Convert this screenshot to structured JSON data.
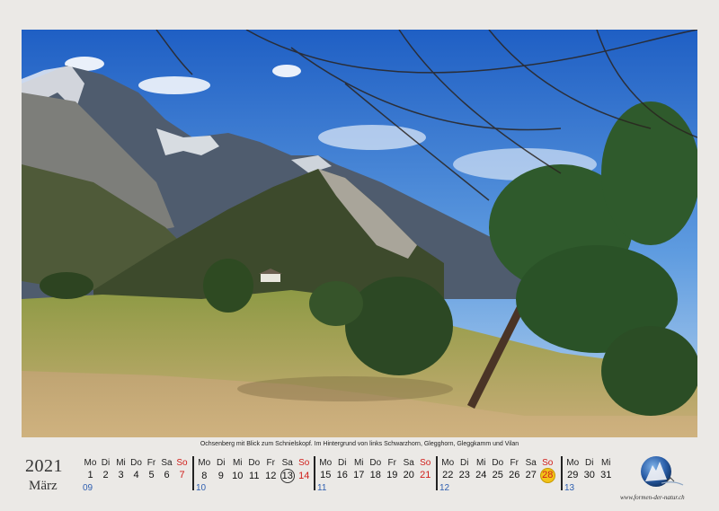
{
  "caption": "Ochsenberg mit Blick zum Schnielskopf. Im Hintergrund von links Schwarzhorn, Glegghorn, Gleggkamm und Vilan",
  "year": "2021",
  "month": "März",
  "weeks": [
    {
      "kw": "09",
      "headers": [
        "Mo",
        "Di",
        "Mi",
        "Do",
        "Fr",
        "Sa",
        "So"
      ],
      "days": [
        "1",
        "2",
        "3",
        "4",
        "5",
        "6",
        "7"
      ]
    },
    {
      "kw": "10",
      "headers": [
        "Mo",
        "Di",
        "Mi",
        "Do",
        "Fr",
        "Sa",
        "So"
      ],
      "days": [
        "8",
        "9",
        "10",
        "11",
        "12",
        "13",
        "14"
      ]
    },
    {
      "kw": "11",
      "headers": [
        "Mo",
        "Di",
        "Mi",
        "Do",
        "Fr",
        "Sa",
        "So"
      ],
      "days": [
        "15",
        "16",
        "17",
        "18",
        "19",
        "20",
        "21"
      ]
    },
    {
      "kw": "12",
      "headers": [
        "Mo",
        "Di",
        "Mi",
        "Do",
        "Fr",
        "Sa",
        "So"
      ],
      "days": [
        "22",
        "23",
        "24",
        "25",
        "26",
        "27",
        "28"
      ]
    },
    {
      "kw": "13",
      "headers": [
        "Mo",
        "Di",
        "Mi"
      ],
      "days": [
        "29",
        "30",
        "31"
      ]
    }
  ],
  "logo": {
    "url": "www.formen-der-natur.ch"
  },
  "colors": {
    "sunday": "#d0201c",
    "week_number": "#2f5fb0",
    "highlight": "#f2c318"
  }
}
